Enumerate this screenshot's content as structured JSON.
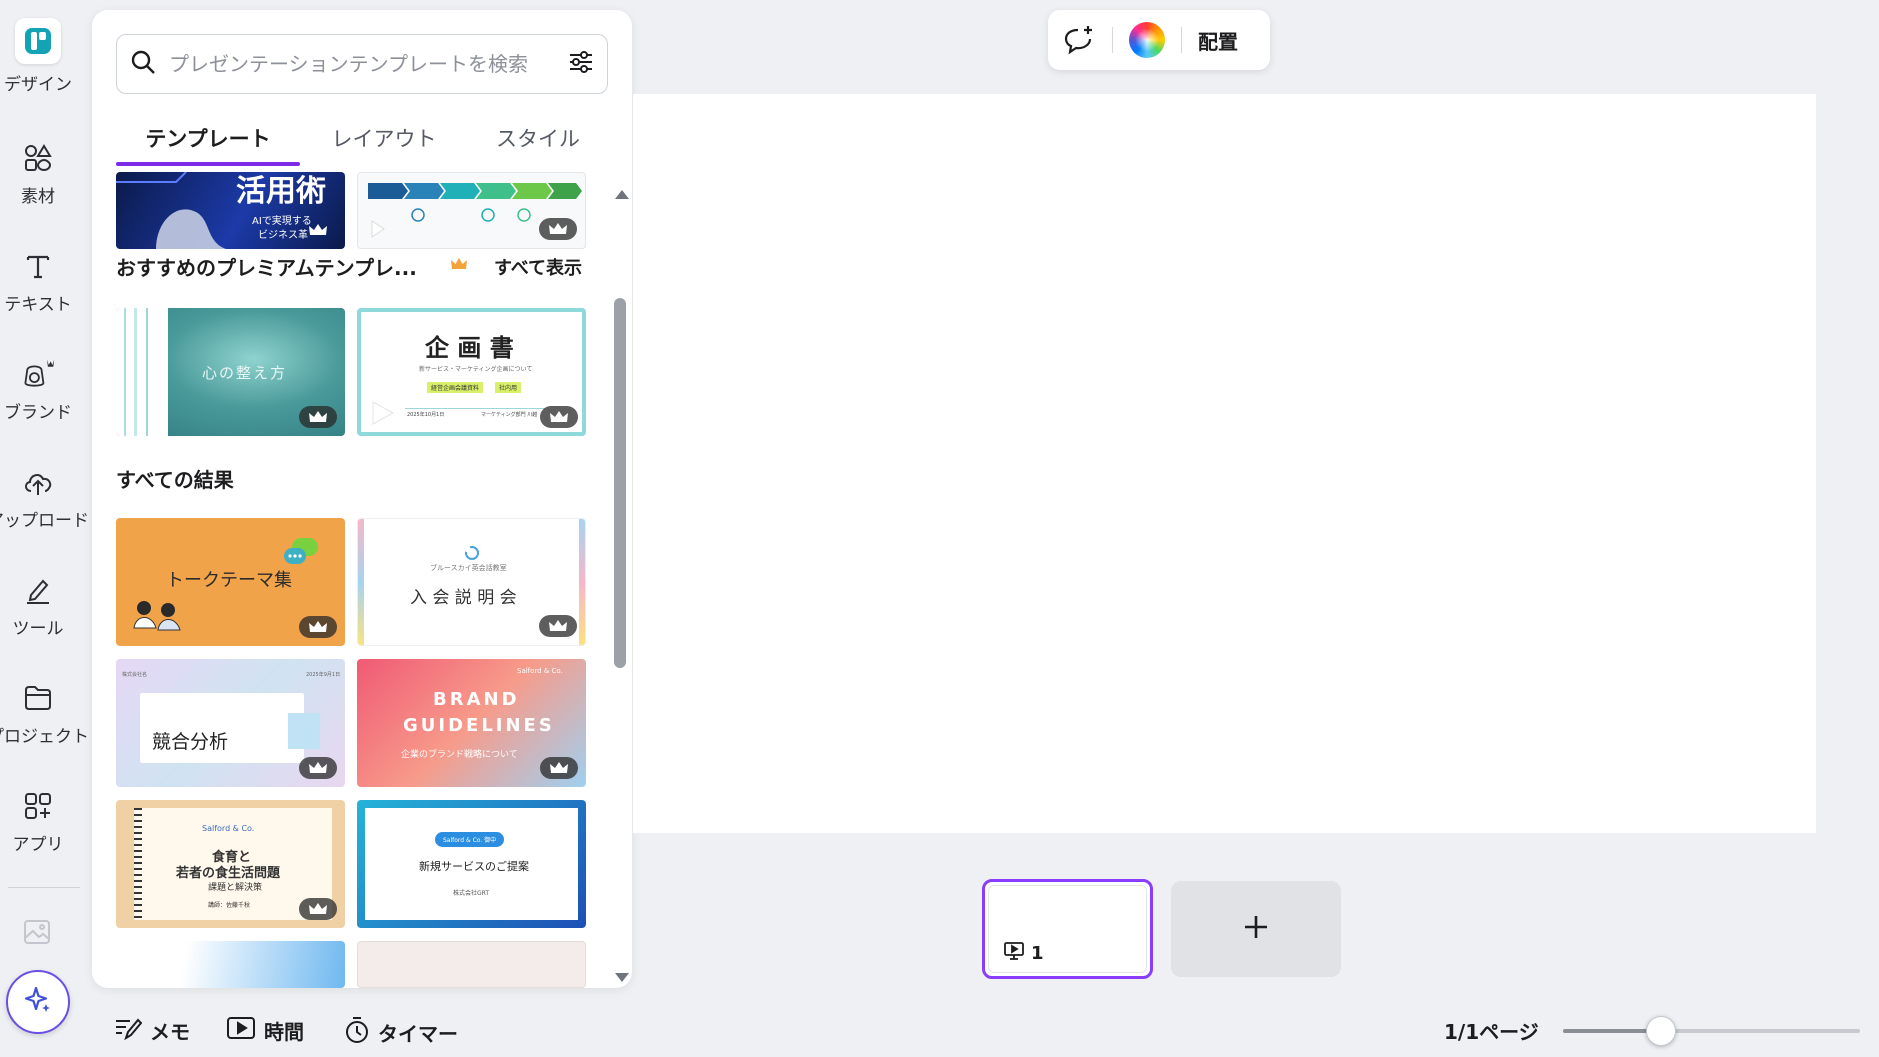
{
  "sidebar": {
    "items": [
      {
        "label": "デザイン",
        "icon": "design-icon"
      },
      {
        "label": "素材",
        "icon": "elements-icon"
      },
      {
        "label": "テキスト",
        "icon": "text-icon"
      },
      {
        "label": "ブランド",
        "icon": "brand-icon"
      },
      {
        "label": "アップロード",
        "icon": "upload-icon"
      },
      {
        "label": "ツール",
        "icon": "tools-icon"
      },
      {
        "label": "プロジェクト",
        "icon": "projects-icon"
      },
      {
        "label": "アプリ",
        "icon": "apps-icon"
      }
    ]
  },
  "panel": {
    "search_placeholder": "プレゼンテーションテンプレートを検索",
    "tabs": [
      "テンプレート",
      "レイアウト",
      "スタイル"
    ],
    "active_tab": 0,
    "premium_section_title": "おすすめのプレミアムテンプレ...",
    "see_all_label": "すべて表示",
    "all_results_title": "すべての結果",
    "top_thumbs": {
      "ai_title": "活用術",
      "ai_sub1": "AIで実現する",
      "ai_sub2": "ビジネス革"
    },
    "premium_thumbs": {
      "water_text": "心の整え方",
      "plan_title": "企 画 書",
      "plan_sub": "新サービス・マーケティング企画について",
      "plan_tags": [
        "経営企画会議資料",
        "社内用"
      ],
      "plan_date": "2025年10月1日",
      "plan_dept": "マーケティング部門 川越"
    },
    "results": [
      {
        "text": "トークテーマ集"
      },
      {
        "text": "入 会 説 明 会",
        "sub": "ブルースカイ英会話教室"
      },
      {
        "text": "競合分析",
        "corner_left": "株式会社名",
        "corner_right": "2025年9月1日"
      },
      {
        "line1": "BRAND",
        "line2": "GUIDELINES",
        "sub": "企業のブランド戦略について",
        "logo": "Salford & Co."
      },
      {
        "logo": "Salford & Co.",
        "line1": "食育と",
        "line2": "若者の食生活問題",
        "sub": "課題と解決策",
        "author": "講師：佐藤千秋"
      },
      {
        "badge": "Salford & Co. 御中",
        "text": "新規サービスのご提案",
        "sub": "株式会社GRT"
      }
    ]
  },
  "toolbar": {
    "arrange_label": "配置"
  },
  "pages": {
    "current_page_number": "1",
    "page_count_label": "1/1ページ"
  },
  "footer": {
    "notes_label": "メモ",
    "duration_label": "時間",
    "timer_label": "タイマー"
  },
  "zoom": {
    "level_fraction": 0.33
  },
  "colors": {
    "accent": "#7d2ae8",
    "selected_page_border": "#8b3dff"
  }
}
